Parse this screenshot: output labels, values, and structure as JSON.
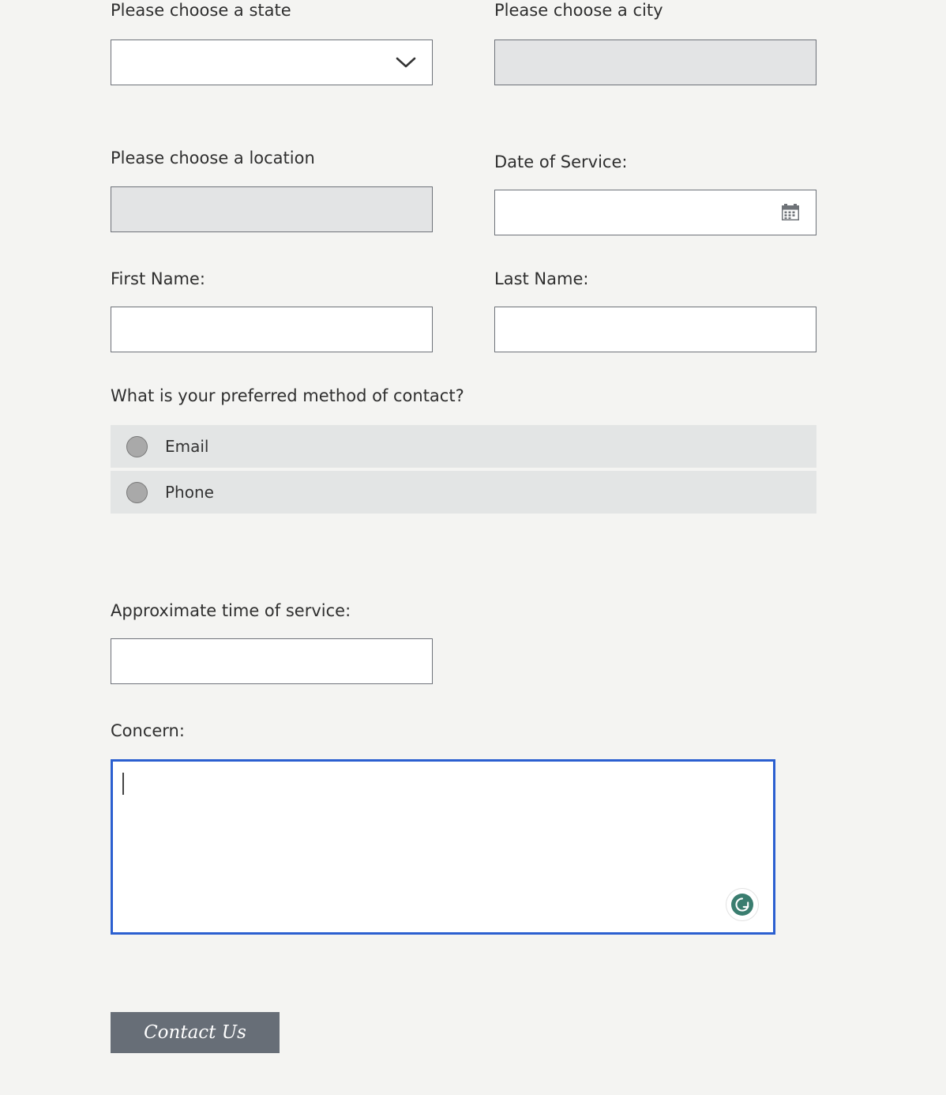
{
  "page": {
    "background_color": "#f4f4f2",
    "text_color": "#2f2f2f"
  },
  "form": {
    "fields": {
      "state": {
        "label": "Please choose a state",
        "value": "",
        "placeholder": "",
        "type": "select",
        "enabled": true,
        "icon": "chevron-down-icon"
      },
      "city": {
        "label": "Please choose a city",
        "value": "",
        "placeholder": "",
        "type": "select",
        "enabled": false
      },
      "location": {
        "label": "Please choose a location",
        "value": "",
        "placeholder": "",
        "type": "select",
        "enabled": false
      },
      "date_of_service": {
        "label": "Date of Service:",
        "value": "",
        "placeholder": "",
        "type": "date",
        "enabled": true,
        "icon": "calendar-icon"
      },
      "first_name": {
        "label": "First Name:",
        "value": "",
        "placeholder": "",
        "type": "text",
        "enabled": true
      },
      "last_name": {
        "label": "Last Name:",
        "value": "",
        "placeholder": "",
        "type": "text",
        "enabled": true
      },
      "approximate_time": {
        "label": "Approximate time of service:",
        "value": "",
        "placeholder": "",
        "type": "text",
        "enabled": true
      },
      "concern": {
        "label": "Concern:",
        "value": "",
        "placeholder": "",
        "type": "textarea",
        "enabled": true,
        "focused": true,
        "focus_border_color": "#2b5fd0",
        "assistant_icon": "grammarly-icon",
        "assistant_icon_color": "#3a7d6f"
      }
    },
    "contact_method": {
      "label": "What is your preferred method of contact?",
      "selected": null,
      "row_background": "#e3e5e5",
      "options": [
        {
          "label": "Email",
          "value": "email",
          "selected": false
        },
        {
          "label": "Phone",
          "value": "phone",
          "selected": false
        }
      ]
    },
    "submit": {
      "label": "Contact Us",
      "background_color": "#676e77",
      "text_color": "#ffffff"
    }
  }
}
